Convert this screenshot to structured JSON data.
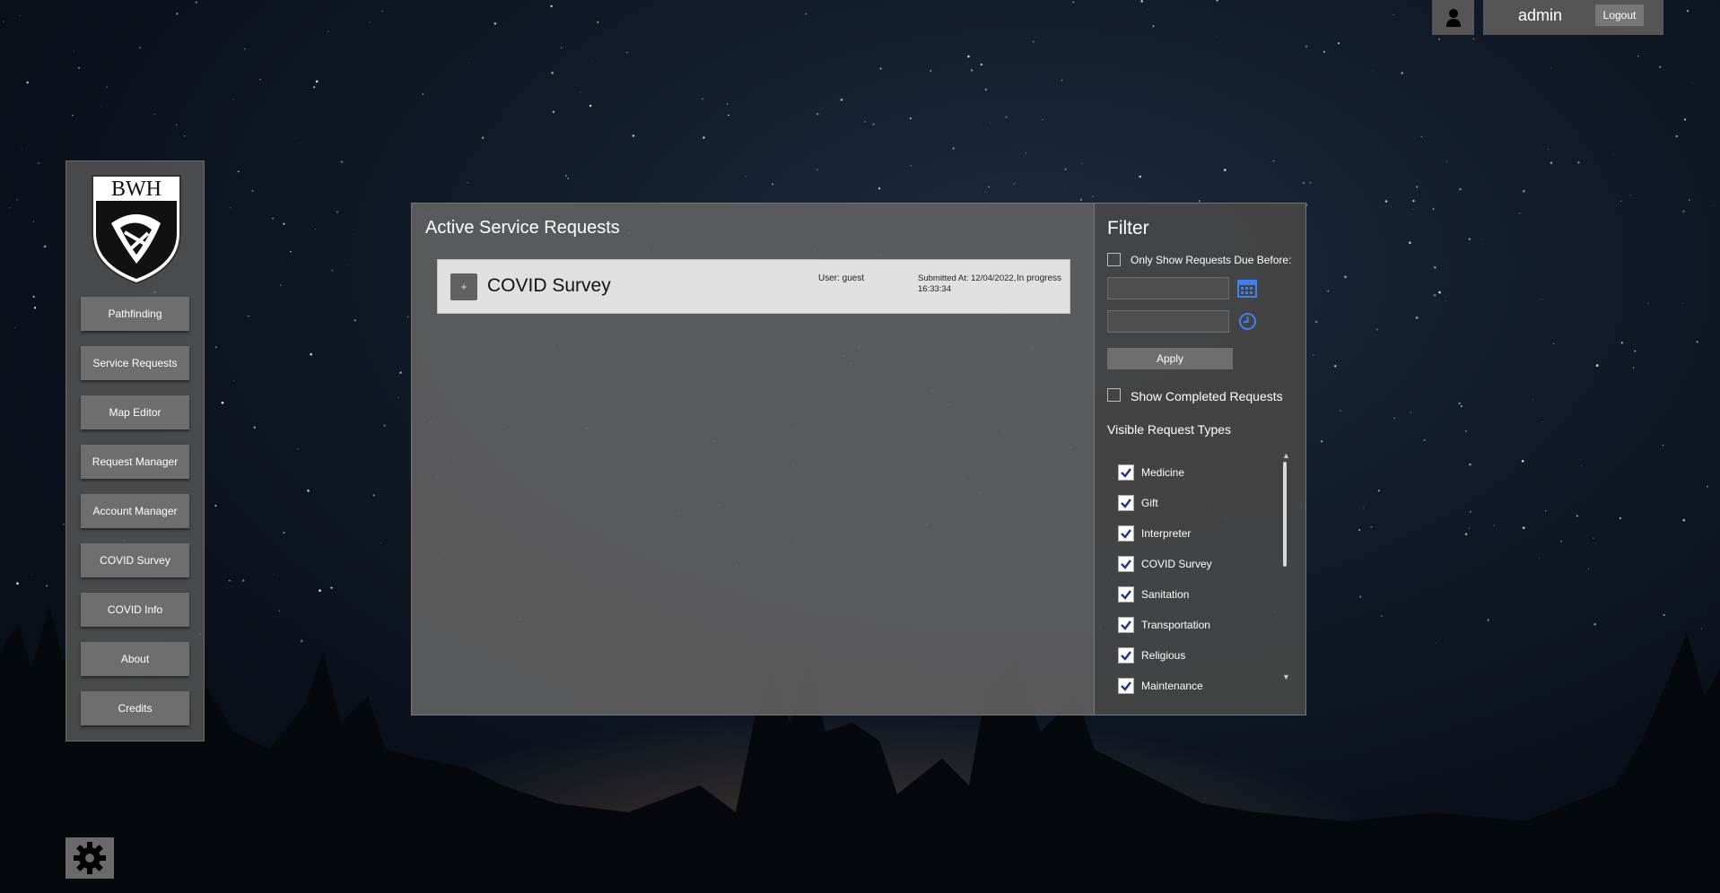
{
  "topbar": {
    "username": "admin",
    "logout_label": "Logout"
  },
  "sidebar": {
    "logo_text": "BWH",
    "items": [
      {
        "label": "Pathfinding"
      },
      {
        "label": "Service Requests"
      },
      {
        "label": "Map Editor"
      },
      {
        "label": "Request Manager"
      },
      {
        "label": "Account Manager"
      },
      {
        "label": "COVID Survey"
      },
      {
        "label": "COVID Info"
      },
      {
        "label": "About"
      },
      {
        "label": "Credits"
      }
    ]
  },
  "main": {
    "title": "Active Service Requests",
    "requests": [
      {
        "expand_label": "+",
        "title": "COVID Survey",
        "user": "User: guest",
        "submitted": "Submitted At: 12/04/2022, 16:33:34",
        "status": "In progress"
      }
    ]
  },
  "filter": {
    "title": "Filter",
    "due_before_label": "Only Show Requests Due Before:",
    "apply_label": "Apply",
    "show_completed_label": "Show Completed Requests",
    "visible_types_title": "Visible Request Types",
    "types": [
      {
        "label": "Medicine",
        "checked": true
      },
      {
        "label": "Gift",
        "checked": true
      },
      {
        "label": "Interpreter",
        "checked": true
      },
      {
        "label": "COVID Survey",
        "checked": true
      },
      {
        "label": "Sanitation",
        "checked": true
      },
      {
        "label": "Transportation",
        "checked": true
      },
      {
        "label": "Religious",
        "checked": true
      },
      {
        "label": "Maintenance",
        "checked": true
      }
    ],
    "accent_color": "#1e3a8a",
    "icon_color": "#3b82f6"
  },
  "icons": {
    "settings": "gear-icon",
    "user": "user-icon",
    "calendar": "calendar-icon",
    "clock": "clock-icon"
  }
}
